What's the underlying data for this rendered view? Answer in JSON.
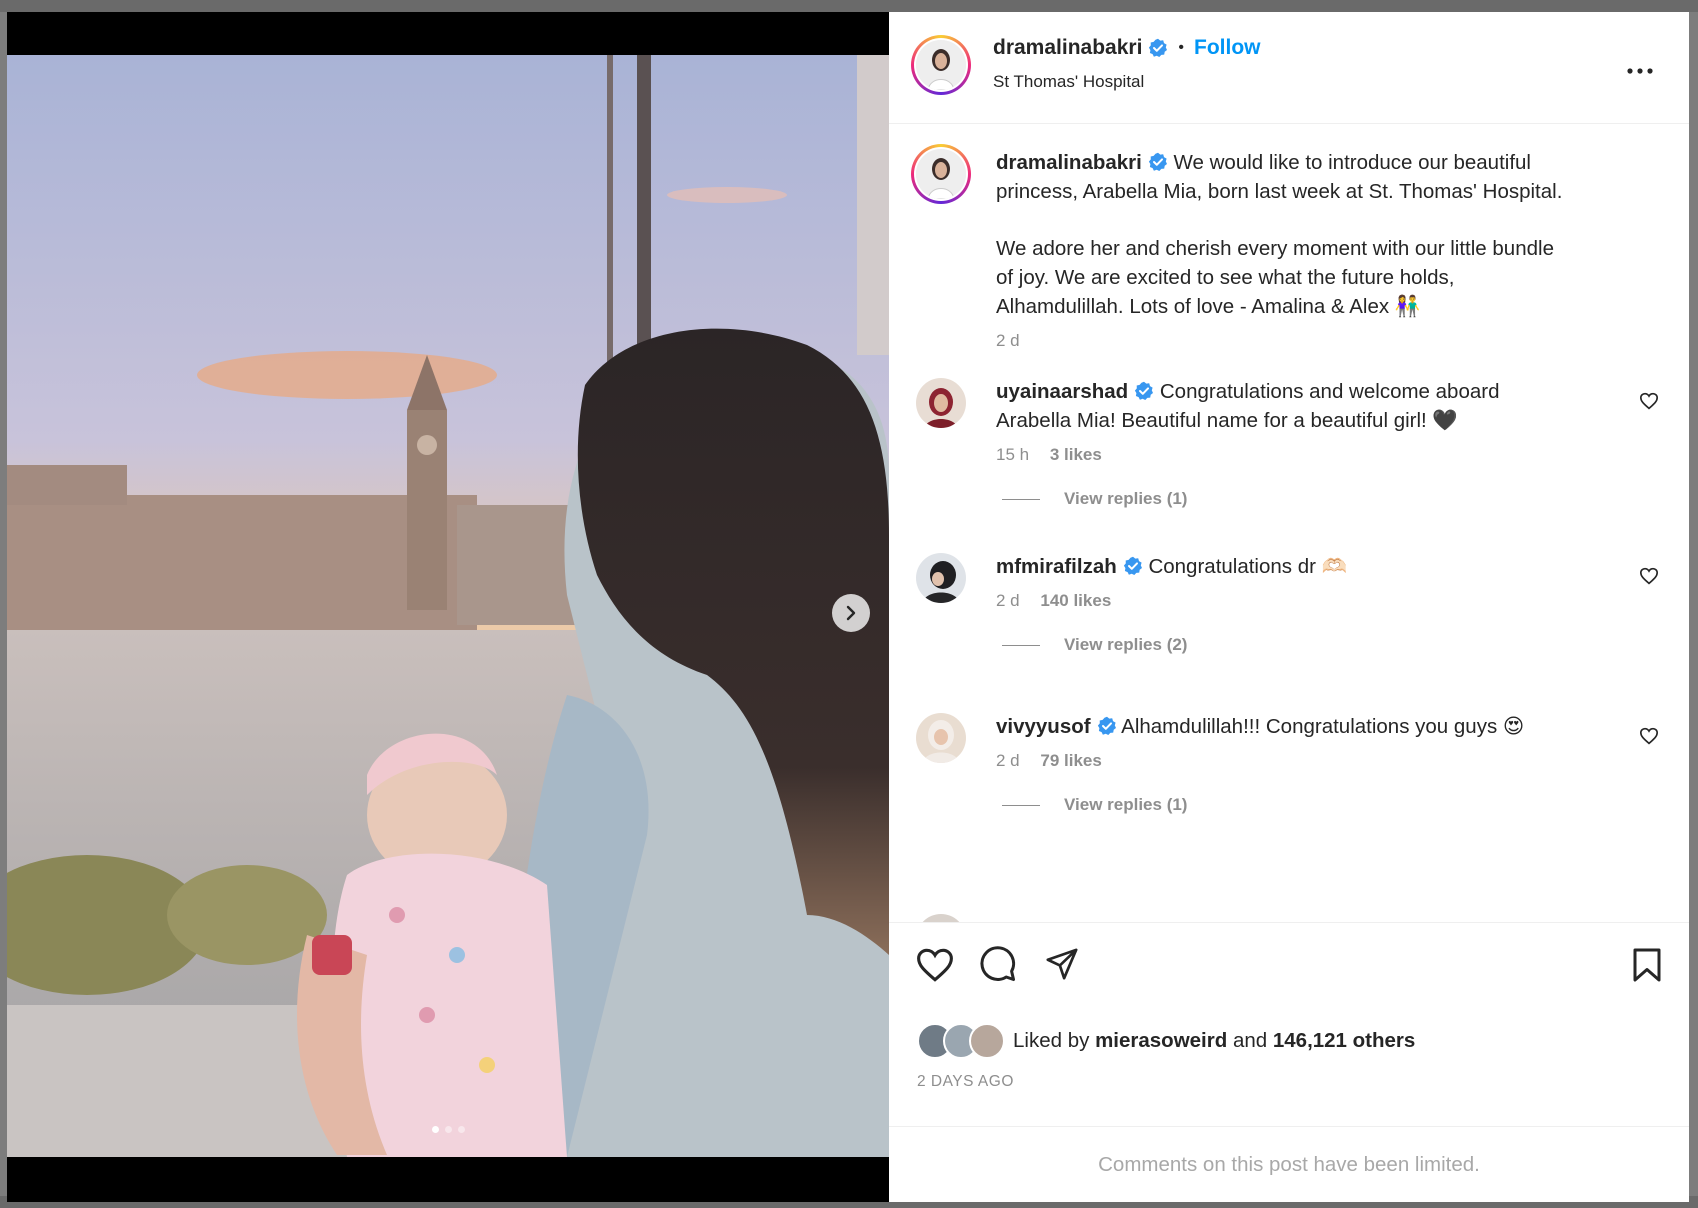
{
  "post": {
    "author": "dramalinabakri",
    "follow_label": "Follow",
    "location": "St Thomas' Hospital"
  },
  "caption": {
    "author": "dramalinabakri",
    "text_line1": "We would like to introduce our beautiful",
    "text_line2": "princess, Arabella Mia, born last week at St. Thomas' Hospital.",
    "text_line3": "We adore her and cherish every moment with our little bundle",
    "text_line4": "of joy. We are excited to see what the future holds,",
    "text_line5": "Alhamdulillah. Lots of love - Amalina & Alex 👫",
    "time": "2 d"
  },
  "comments": [
    {
      "author": "uyainaarshad",
      "text_line1": "Congratulations and welcome aboard",
      "text_line2": "Arabella Mia! Beautiful name for a beautiful girl! 🖤",
      "time": "15 h",
      "likes": "3 likes",
      "replies": "View replies (1)"
    },
    {
      "author": "mfmirafilzah",
      "text_line1": "Congratulations dr 🫶🏻",
      "time": "2 d",
      "likes": "140 likes",
      "replies": "View replies (2)"
    },
    {
      "author": "vivyyusof",
      "text_line1": "Alhamdulillah!!! Congratulations you guys 😍",
      "time": "2 d",
      "likes": "79 likes",
      "replies": "View replies (1)"
    }
  ],
  "likes": {
    "prefix": "Liked by",
    "user": "mierasoweird",
    "and": "and",
    "others": "146,121 others"
  },
  "date": "2 DAYS AGO",
  "limited_notice": "Comments on this post have been limited.",
  "carousel": {
    "current": 1,
    "total": 3
  },
  "colors": {
    "link": "#0095f6",
    "verified": "#3897f0",
    "muted": "#8e8e8e"
  },
  "icons": [
    "verified-badge-icon",
    "more-icon",
    "heart-icon",
    "comment-icon",
    "share-icon",
    "bookmark-icon",
    "next-arrow-icon"
  ]
}
